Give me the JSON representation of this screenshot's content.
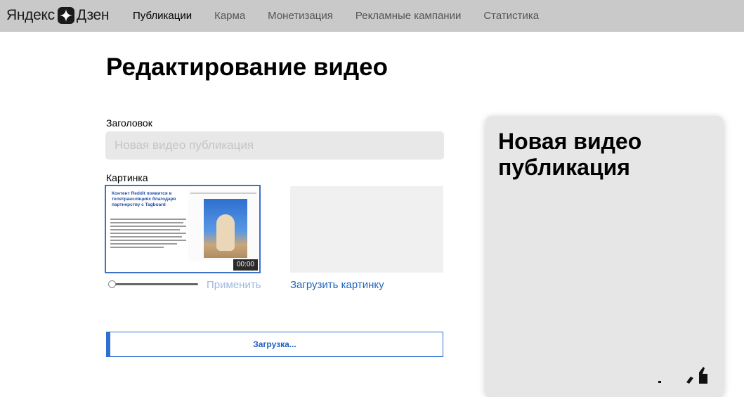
{
  "header": {
    "logo": {
      "left": "Яндекс",
      "right": "Дзен"
    },
    "nav": [
      {
        "label": "Публикации",
        "active": true
      },
      {
        "label": "Карма",
        "active": false
      },
      {
        "label": "Монетизация",
        "active": false
      },
      {
        "label": "Рекламные кампании",
        "active": false
      },
      {
        "label": "Статистика",
        "active": false
      }
    ]
  },
  "page": {
    "title": "Редактирование видео"
  },
  "form": {
    "title_label": "Заголовок",
    "title_value": "",
    "title_placeholder": "Новая видео публикация",
    "image_label": "Картинка",
    "thumbnail": {
      "headline": "Контент Reddit появится в телетрансляциях благодаря партнерству с Tagboard",
      "duration": "00:00"
    },
    "apply_label": "Применить",
    "upload_image_label": "Загрузить картинку",
    "upload_progress": {
      "label": "Загрузка...",
      "fraction": 0.01
    }
  },
  "preview": {
    "title": "Новая видео публикация",
    "icon": "like-icon"
  },
  "colors": {
    "accent": "#2f6fcf",
    "link": "#1f66c1",
    "link_disabled": "#9fb8df",
    "header_bg": "#c9c9c9",
    "input_bg": "#e8e8e8",
    "card_bg": "#e6e6e6"
  }
}
